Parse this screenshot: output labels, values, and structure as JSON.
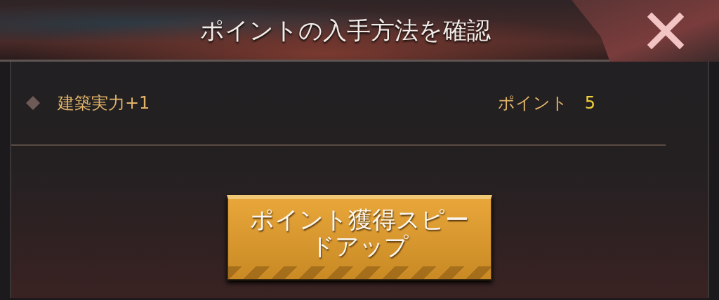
{
  "window": {
    "title": "ポイントの入手方法を確認"
  },
  "rows": [
    {
      "label": "建築実力+1",
      "points_label": "ポイント",
      "points": "5"
    }
  ],
  "button": {
    "label": "ポイント獲得スピードアップ"
  }
}
